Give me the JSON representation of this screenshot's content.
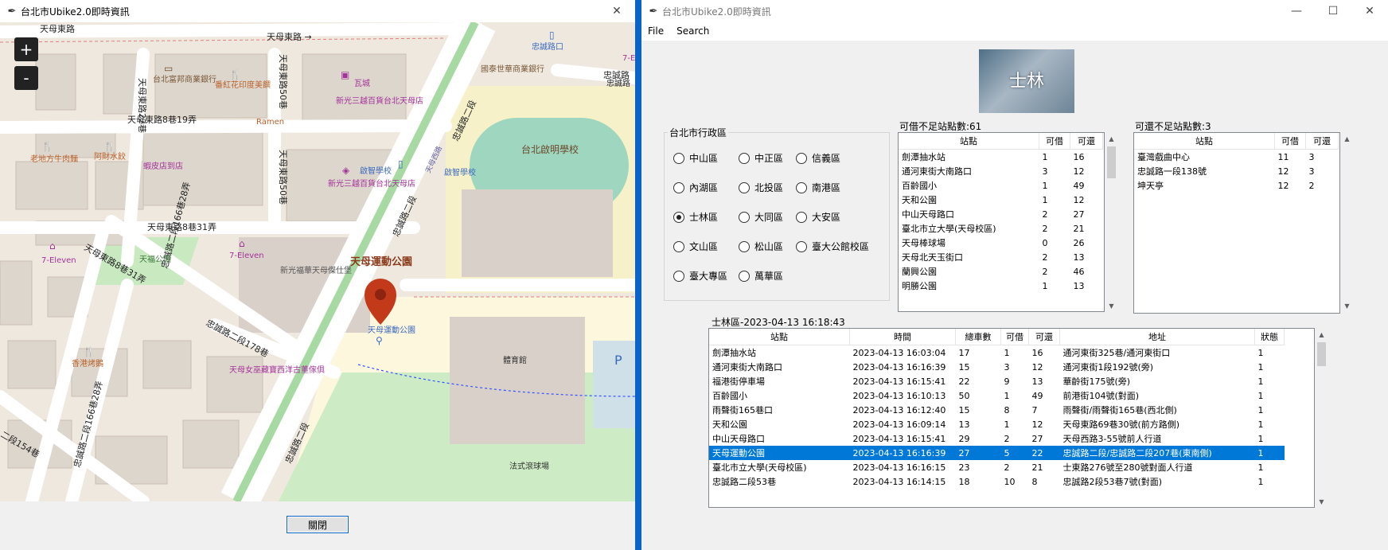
{
  "map_window": {
    "title": "台北市Ubike2.0即時資訊",
    "close_glyph": "✕",
    "zoom_in": "+",
    "zoom_out": "-",
    "close_button": "關閉",
    "map_labels": {
      "road1": "天母東路",
      "road2": "天母東路",
      "road3": "天母東路 →",
      "road4": "天母東路50巷",
      "road5": "天母東路22巷",
      "road6": "天母東路8巷19弄",
      "road7": "天母東路50巷",
      "road8": "天母東路8巷31弄",
      "road9": "天母東路8巷31弄",
      "road10": "忠誠路二段166巷28弄",
      "road11": "忠誠路二段178巷",
      "road12": "忠誠路二段166巷28弄",
      "road13": "忠誠路二段",
      "road14": "忠誠路二段",
      "road15": "忠誠路二段",
      "road16": "忠誠路",
      "road17": "二段154巷",
      "road18": "天母西路",
      "poi1": "台北富邦商業銀行",
      "poi2": "番紅花印度美饌",
      "poi3": "瓦城",
      "poi4": "新光三越百貨台北天母店",
      "poi5": "Ramen",
      "poi6": "老地方牛肉麵",
      "poi7": "阿財水餃",
      "poi8": "蝦皮店到店",
      "poi9": "新光三越百貨台北天母店",
      "poi10": "啟智學校",
      "poi11": "啟智學校",
      "poi12": "國泰世華商業銀行",
      "poi13": "忠誠路口",
      "poi14": "台北啟明學校",
      "poi15": "7-Eleven",
      "poi16": "天福公園",
      "poi17": "7-Eleven",
      "poi18": "新光福華天母傑仕堡",
      "poi19": "天母運動公園",
      "poi20": "天母運動公園",
      "poi21": "香港烤鵝",
      "poi22": "天母女巫藏寶西洋古董傢俱",
      "poi23": "體育館",
      "poi24": "法式滾球場",
      "poi25": "P",
      "poi26": "7-E",
      "poi27": "忠誠路"
    }
  },
  "info_window": {
    "title": "台北市Ubike2.0即時資訊",
    "menu": [
      "File",
      "Search"
    ],
    "photo_caption": "士林",
    "district_group": {
      "legend": "台北市行政區",
      "options": [
        "中山區",
        "中正區",
        "信義區",
        "內湖區",
        "北投區",
        "南港區",
        "士林區",
        "大同區",
        "大安區",
        "文山區",
        "松山區",
        "臺大公館校區",
        "臺大專區",
        "萬華區"
      ],
      "selected": "士林區"
    },
    "low_bikes": {
      "label": "可借不足站點數:61",
      "headers": [
        "站點",
        "可借",
        "可還"
      ],
      "rows": [
        [
          "劍潭抽水站",
          "1",
          "16"
        ],
        [
          "通河東街大南路口",
          "3",
          "12"
        ],
        [
          "百齡國小",
          "1",
          "49"
        ],
        [
          "天和公園",
          "1",
          "12"
        ],
        [
          "中山天母路口",
          "2",
          "27"
        ],
        [
          "臺北市立大學(天母校區)",
          "2",
          "21"
        ],
        [
          "天母棒球場",
          "0",
          "26"
        ],
        [
          "天母北天玉街口",
          "2",
          "13"
        ],
        [
          "蘭興公園",
          "2",
          "46"
        ],
        [
          "明勝公園",
          "1",
          "13"
        ]
      ]
    },
    "low_docks": {
      "label": "可還不足站點數:3",
      "headers": [
        "站點",
        "可借",
        "可還"
      ],
      "rows": [
        [
          "臺灣戲曲中心",
          "11",
          "3"
        ],
        [
          "忠誠路一段138號",
          "12",
          "3"
        ],
        [
          "坤天亭",
          "12",
          "2"
        ]
      ]
    },
    "detail": {
      "label": "士林區-2023-04-13 16:18:43",
      "headers": [
        "站點",
        "時間",
        "總車數",
        "可借",
        "可還",
        "地址",
        "狀態"
      ],
      "selected_index": 7,
      "rows": [
        [
          "劍潭抽水站",
          "2023-04-13 16:03:04",
          "17",
          "1",
          "16",
          "通河東街325巷/通河東街口",
          "1"
        ],
        [
          "通河東街大南路口",
          "2023-04-13 16:16:39",
          "15",
          "3",
          "12",
          "通河東街1段192號(旁)",
          "1"
        ],
        [
          "福港街停車場",
          "2023-04-13 16:15:41",
          "22",
          "9",
          "13",
          "華齡街175號(旁)",
          "1"
        ],
        [
          "百齡國小",
          "2023-04-13 16:10:13",
          "50",
          "1",
          "49",
          "前港街104號(對面)",
          "1"
        ],
        [
          "雨聲街165巷口",
          "2023-04-13 16:12:40",
          "15",
          "8",
          "7",
          "雨聲街/雨聲街165巷(西北側)",
          "1"
        ],
        [
          "天和公園",
          "2023-04-13 16:09:14",
          "13",
          "1",
          "12",
          "天母東路69巷30號(前方路側)",
          "1"
        ],
        [
          "中山天母路口",
          "2023-04-13 16:15:41",
          "29",
          "2",
          "27",
          "天母西路3-55號前人行道",
          "1"
        ],
        [
          "天母運動公園",
          "2023-04-13 16:16:39",
          "27",
          "5",
          "22",
          "忠誠路二段/忠誠路二段207巷(東南側)",
          "1"
        ],
        [
          "臺北市立大學(天母校區)",
          "2023-04-13 16:16:15",
          "23",
          "2",
          "21",
          "士東路276號至280號對面人行道",
          "1"
        ],
        [
          "忠誠路二段53巷",
          "2023-04-13 16:14:15",
          "18",
          "10",
          "8",
          "忠誠路2段53巷7號(對面)",
          "1"
        ]
      ]
    },
    "colors": {
      "selection": "#0078d7",
      "marker": "#c23a1a"
    }
  }
}
